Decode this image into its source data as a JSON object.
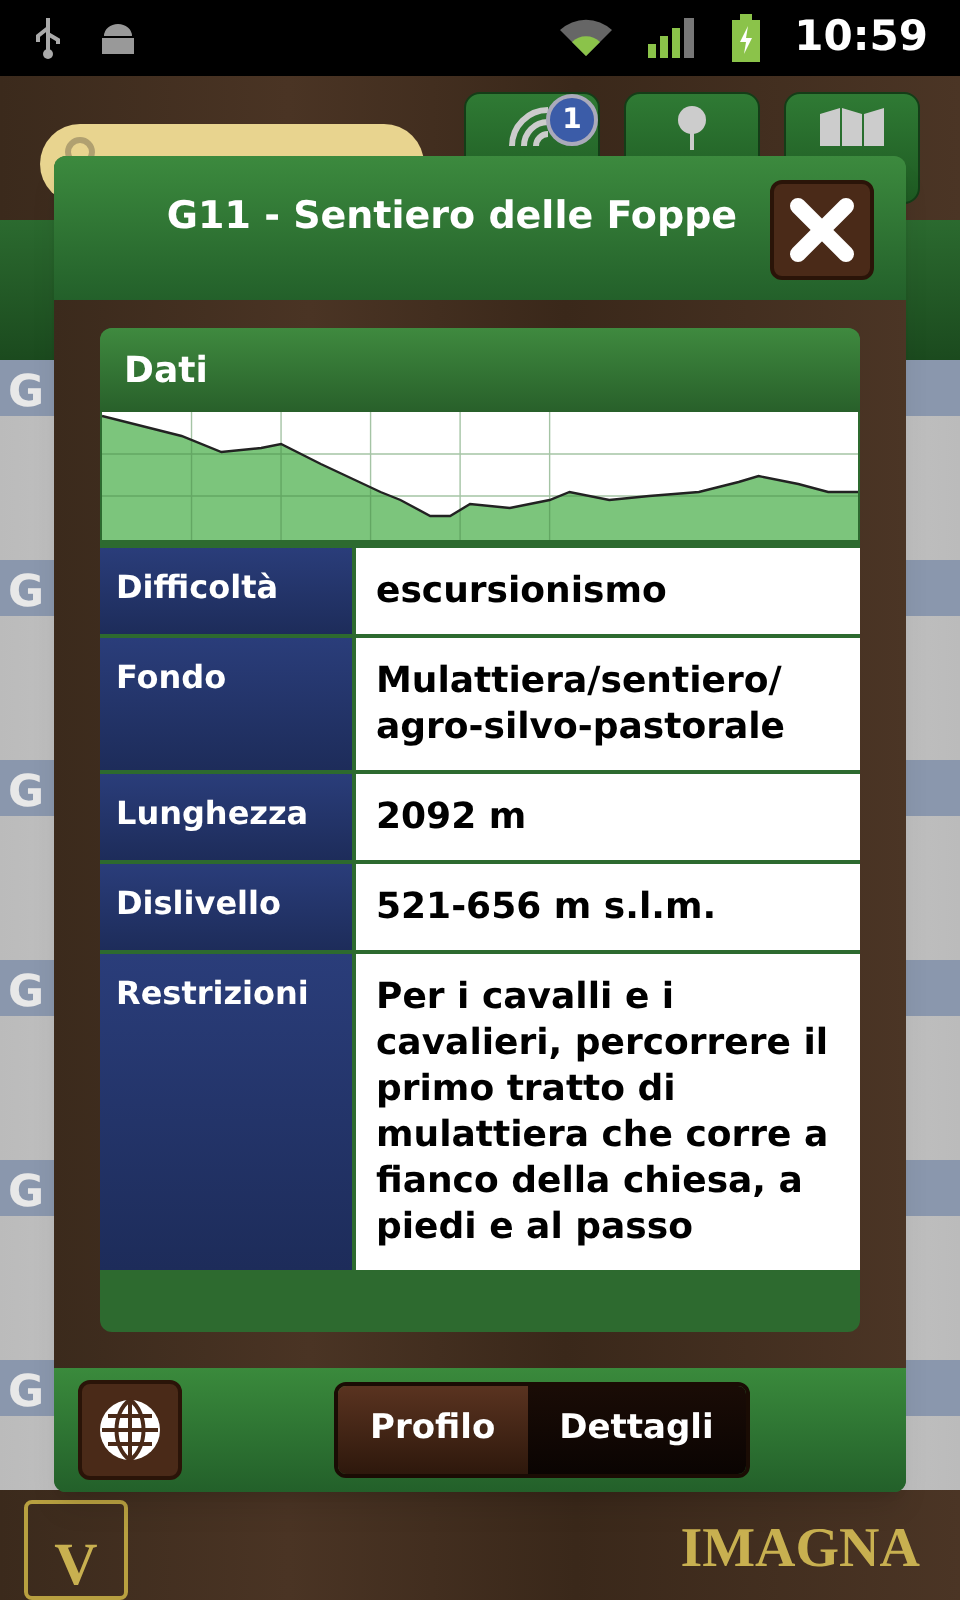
{
  "status_bar": {
    "time": "10:59"
  },
  "toolbar": {
    "nearby_badge": "1"
  },
  "background_list": [
    {
      "label": "G"
    },
    {
      "label": "G"
    },
    {
      "label": "G"
    },
    {
      "label": "G"
    },
    {
      "label": "G"
    },
    {
      "label": "G"
    }
  ],
  "dialog": {
    "title": "G11 - Sentiero delle Foppe",
    "section_title": "Dati",
    "rows": [
      {
        "label": "Difficoltà",
        "value": "escursionismo"
      },
      {
        "label": "Fondo",
        "value": "Mulattiera/sentiero/ agro-silvo-pastorale"
      },
      {
        "label": "Lunghezza",
        "value": "2092 m"
      },
      {
        "label": "Dislivello",
        "value": "521-656 m s.l.m."
      },
      {
        "label": "Restrizioni",
        "value": "Per i cavalli e i cavalieri, percorrere il primo tratto di mulattiera che corre a fianco della chiesa, a piedi e al passo"
      }
    ],
    "tabs": [
      {
        "label": "Profilo",
        "selected": false
      },
      {
        "label": "Dettagli",
        "selected": true
      }
    ]
  },
  "brand": {
    "logo_letter": "V",
    "name": "IMAGNA"
  }
}
